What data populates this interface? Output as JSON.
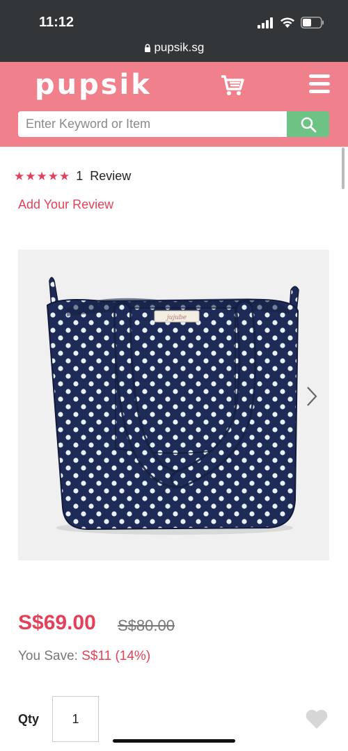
{
  "status": {
    "time": "11:12",
    "url": "pupsik.sg"
  },
  "header": {
    "logo": "pupsik",
    "search": {
      "placeholder": "Enter Keyword or Item",
      "value": ""
    },
    "brand_color": "#f0808c",
    "search_button_color": "#6cc383"
  },
  "product": {
    "rating": {
      "stars": "★★★★★",
      "stars_value": 5,
      "count": "1",
      "label": "Review"
    },
    "add_review": "Add Your Review",
    "gallery": {
      "image_description_icon": "polka-dot-tote-bag",
      "bag_tag": "jujube"
    },
    "price": {
      "current": "S$69.00",
      "original": "S$80.00",
      "save_label": "You Save:",
      "save_amount": "S$11 (14%)"
    },
    "qty": {
      "label": "Qty",
      "value": "1"
    },
    "accent_color": "#e5405a"
  }
}
